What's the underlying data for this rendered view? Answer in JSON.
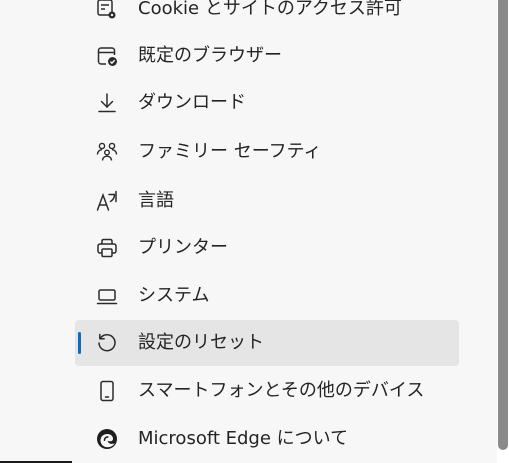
{
  "sidebar": {
    "items": [
      {
        "label": "Cookie とサイトのアクセス許可",
        "icon": "cookie-site-permissions-icon"
      },
      {
        "label": "既定のブラウザー",
        "icon": "default-browser-icon"
      },
      {
        "label": "ダウンロード",
        "icon": "download-icon"
      },
      {
        "label": "ファミリー セーフティ",
        "icon": "family-safety-icon"
      },
      {
        "label": "言語",
        "icon": "language-icon"
      },
      {
        "label": "プリンター",
        "icon": "printer-icon"
      },
      {
        "label": "システム",
        "icon": "system-laptop-icon"
      },
      {
        "label": "設定のリセット",
        "icon": "reset-icon",
        "selected": true
      },
      {
        "label": "スマートフォンとその他のデバイス",
        "icon": "phone-icon"
      },
      {
        "label": "Microsoft Edge について",
        "icon": "edge-logo-icon"
      }
    ]
  },
  "colors": {
    "accent": "#0f6cbd",
    "selected_bg": "#e5e5e5",
    "panel_bg": "#f7f7f7",
    "text": "#242424",
    "icon": "#2b2b2b"
  }
}
